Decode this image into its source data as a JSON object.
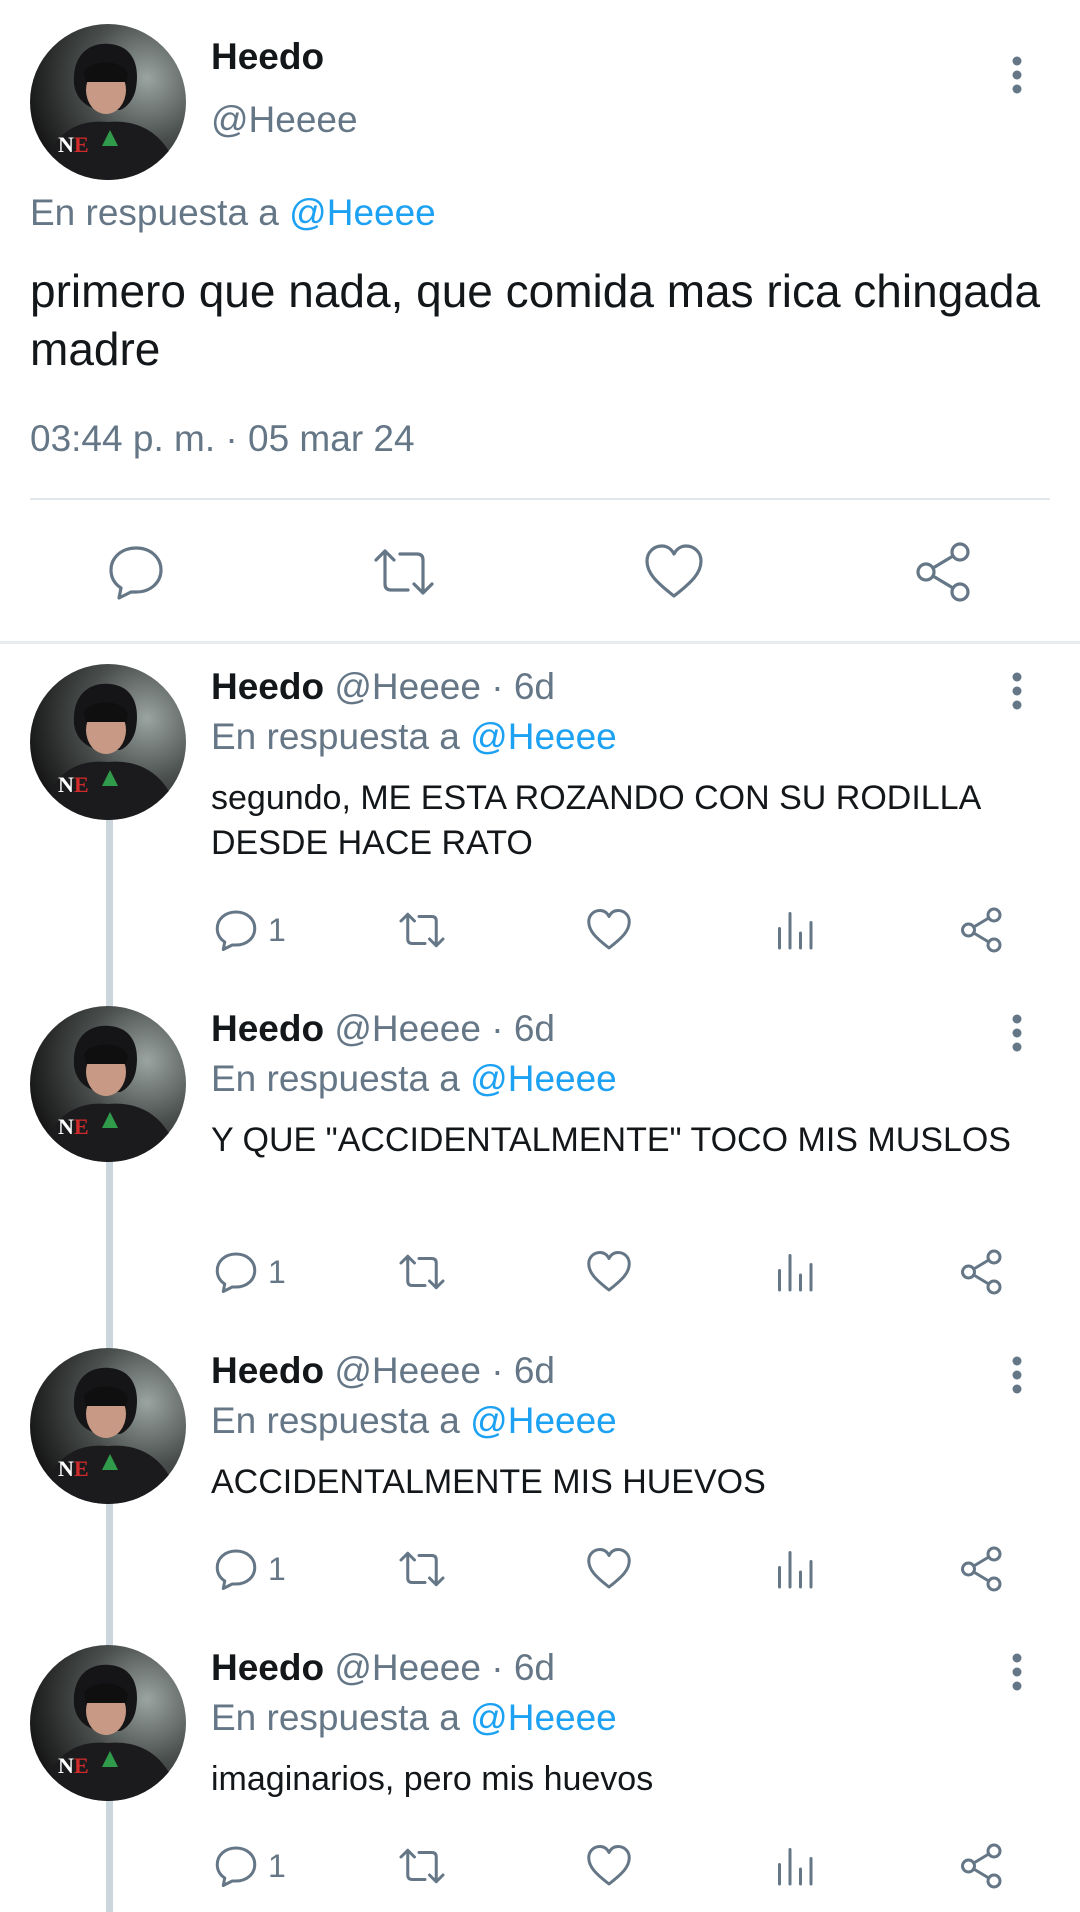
{
  "main_tweet": {
    "name": "Heedo",
    "handle": "@Heeee",
    "reply_prefix": "En respuesta a",
    "reply_to": "@Heeee",
    "text": "primero que nada, que comida mas rica chingada madre",
    "timestamp": "03:44 p. m. · 05 mar 24",
    "actions": [
      {
        "icon": "reply-icon"
      },
      {
        "icon": "retweet-icon"
      },
      {
        "icon": "heart-icon"
      },
      {
        "icon": "share-icon"
      }
    ]
  },
  "replies": [
    {
      "name": "Heedo",
      "handle_time": "@Heeee · 6d",
      "reply_prefix": "En respuesta a",
      "reply_to": "@Heeee",
      "text": "segundo, ME ESTA ROZANDO CON SU RODILLA DESDE HACE RATO",
      "reply_count": "1"
    },
    {
      "name": "Heedo",
      "handle_time": "@Heeee · 6d",
      "reply_prefix": "En respuesta a",
      "reply_to": "@Heeee",
      "text": "Y QUE \"ACCIDENTALMENTE\" TOCO MIS MUSLOS",
      "reply_count": "1"
    },
    {
      "name": "Heedo",
      "handle_time": "@Heeee · 6d",
      "reply_prefix": "En respuesta a",
      "reply_to": "@Heeee",
      "text": "ACCIDENTALMENTE MIS HUEVOS",
      "reply_count": "1"
    },
    {
      "name": "Heedo",
      "handle_time": "@Heeee · 6d",
      "reply_prefix": "En respuesta a",
      "reply_to": "@Heeee",
      "text": "imaginarios, pero mis huevos",
      "reply_count": "1"
    }
  ],
  "colors": {
    "link": "#1da1f2",
    "secondary_text": "#657786",
    "divider": "#e1e8ed",
    "thread_line": "#ccd6dd"
  }
}
